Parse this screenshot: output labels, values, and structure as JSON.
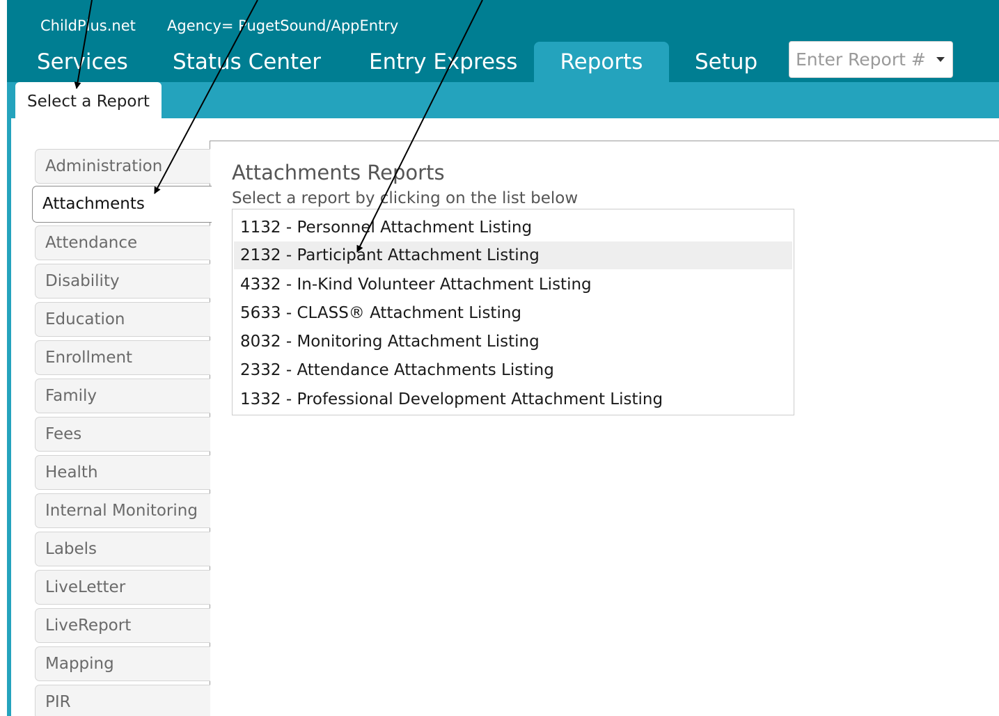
{
  "header": {
    "app_title": "ChildPlus.net",
    "agency": "Agency= PugetSound/AppEntry",
    "tabs": [
      "Services",
      "Status Center",
      "Entry Express",
      "Reports",
      "Setup"
    ],
    "active_tab": "Reports",
    "report_search": {
      "placeholder": "Enter Report #"
    }
  },
  "subtabs": {
    "active": "Select a Report"
  },
  "categories": [
    "Administration",
    "Attachments",
    "Attendance",
    "Disability",
    "Education",
    "Enrollment",
    "Family",
    "Fees",
    "Health",
    "Internal Monitoring",
    "Labels",
    "LiveLetter",
    "LiveReport",
    "Mapping",
    "PIR"
  ],
  "active_category": "Attachments",
  "main": {
    "title": "Attachments Reports",
    "instruction": "Select a report by clicking on the list below",
    "reports": [
      "1132 - Personnel Attachment Listing",
      "2132 - Participant Attachment Listing",
      "4332 - In-Kind Volunteer Attachment Listing",
      "5633 - CLASS® Attachment Listing",
      "8032 - Monitoring Attachment Listing",
      "2332 - Attendance Attachments Listing",
      "1332 - Professional Development Attachment Listing"
    ],
    "highlighted_report": "2132 - Participant Attachment Listing"
  },
  "colors": {
    "header": "#007e92",
    "subband": "#24a3bd",
    "category_bg": "#f4f4f4",
    "hover": "#eeeeee"
  }
}
